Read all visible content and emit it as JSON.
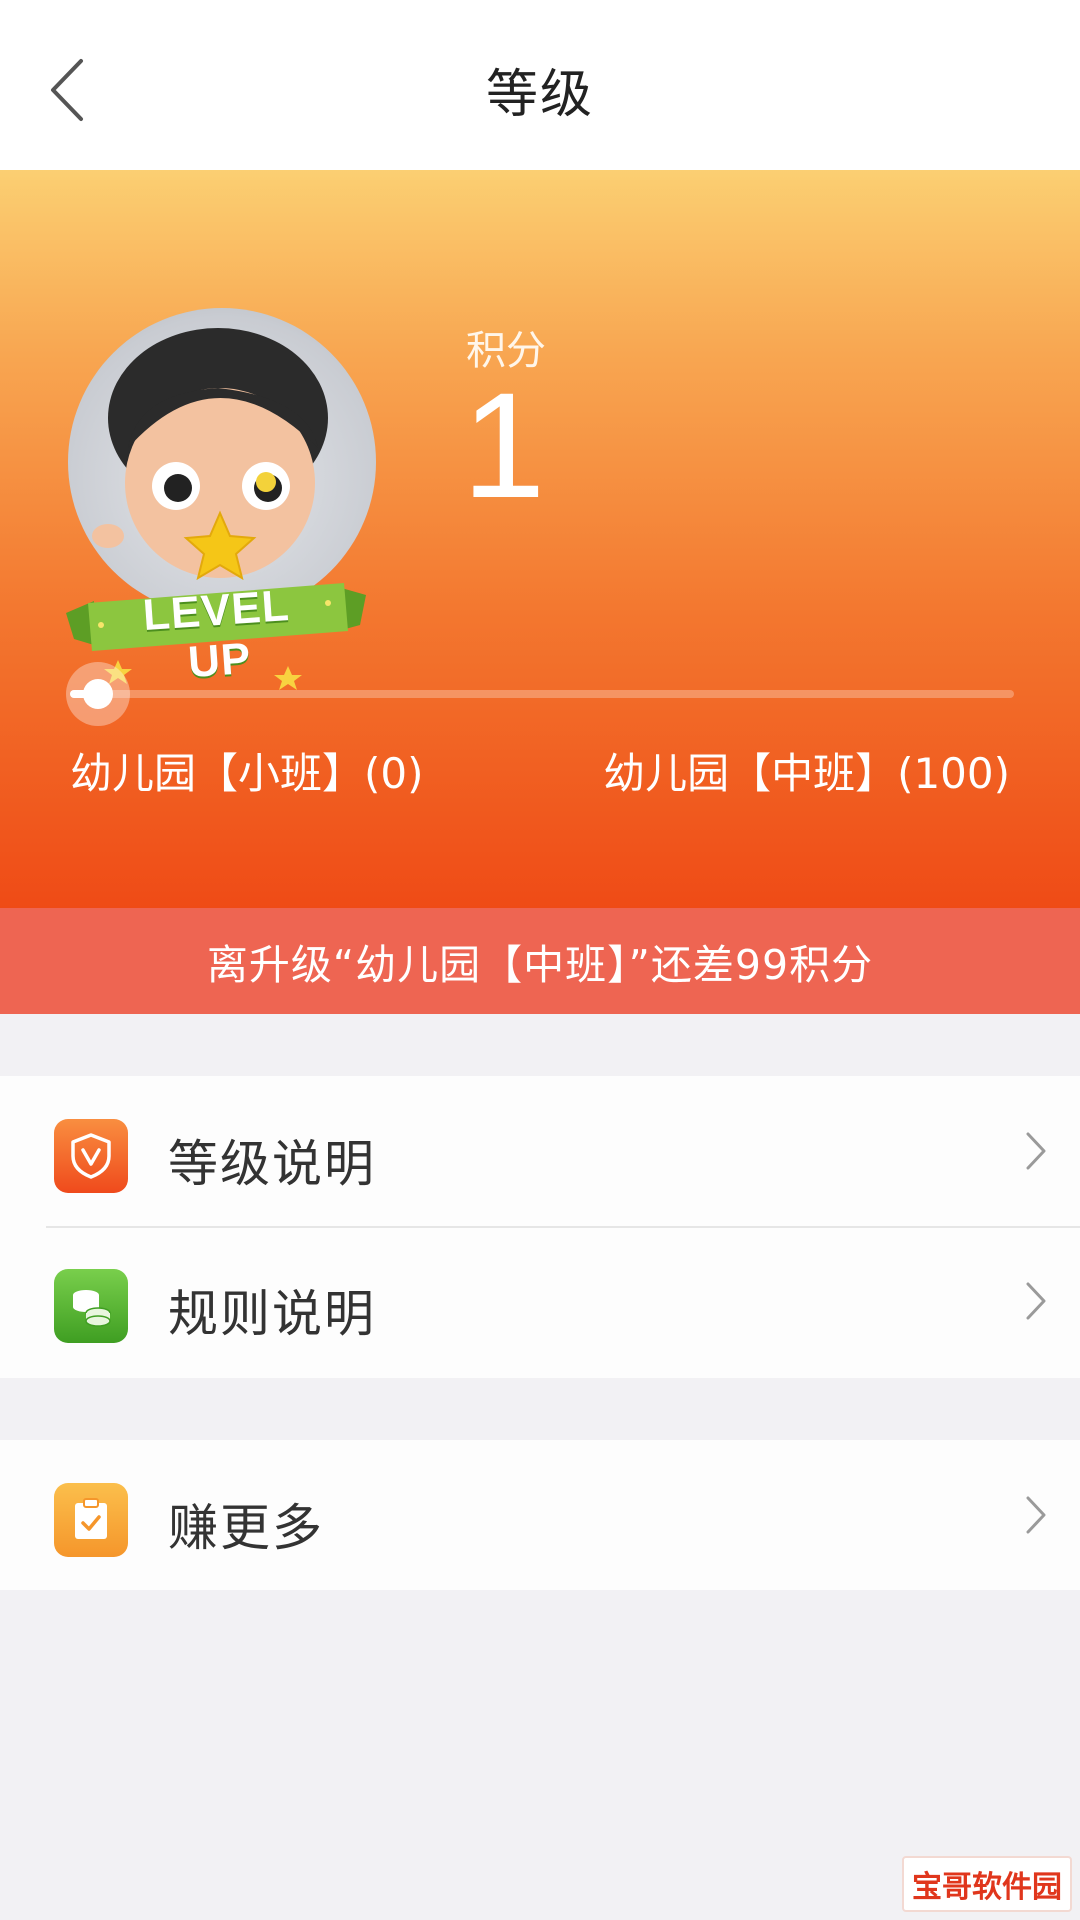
{
  "header": {
    "title": "等级"
  },
  "points": {
    "label": "积分",
    "value": "1"
  },
  "avatar": {
    "badge_text": "LEVEL UP"
  },
  "progress": {
    "fraction": 0.01,
    "current_level": "幼儿园【小班】(0)",
    "next_level": "幼儿园【中班】(100)"
  },
  "upgrade_notice": "离升级“幼儿园【中班】”还差99积分",
  "menu": {
    "level_desc": "等级说明",
    "rule_desc": "规则说明",
    "earn_more": "赚更多"
  },
  "watermark": "宝哥软件园",
  "colors": {
    "hero_top": "#fbcf72",
    "hero_bottom": "#ef4b16",
    "notice_bar": "#ee6552",
    "background": "#f2f1f4"
  }
}
